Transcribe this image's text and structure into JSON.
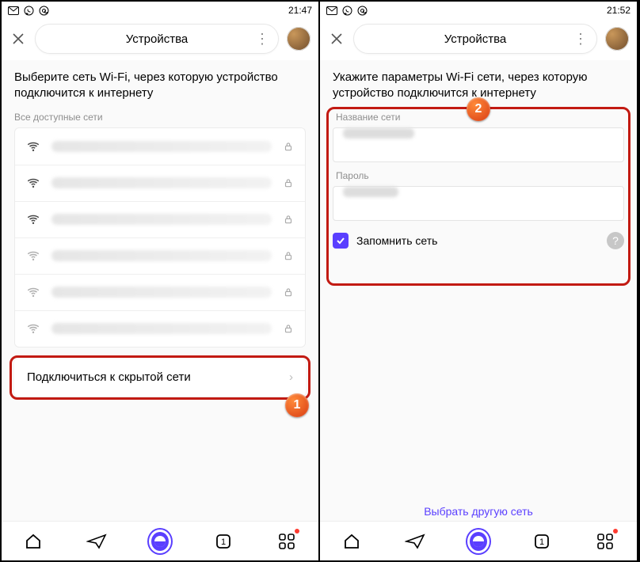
{
  "left": {
    "statusbar": {
      "time": "21:47"
    },
    "header": {
      "title": "Устройства"
    },
    "heading": "Выберите сеть Wi-Fi, через которую устройство подключится к интернету",
    "subhead": "Все доступные сети",
    "hidden_network_label": "Подключиться к скрытой сети",
    "callout_marker": "1"
  },
  "right": {
    "statusbar": {
      "time": "21:52"
    },
    "header": {
      "title": "Устройства"
    },
    "heading": "Укажите параметры Wi-Fi сети, через которую устройство подключится к интернету",
    "ssid_label": "Название сети",
    "password_label": "Пароль",
    "remember_label": "Запомнить сеть",
    "alt_network_label": "Выбрать другую сеть",
    "callout_marker": "2"
  }
}
